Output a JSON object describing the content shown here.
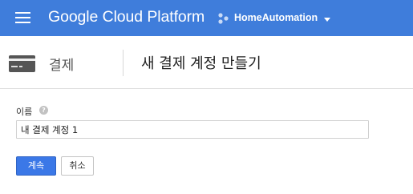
{
  "topbar": {
    "brand": "Google Cloud Platform",
    "project_name": "HomeAutomation",
    "icons": [
      "menu-icon",
      "project-icon",
      "chevron-down-icon"
    ]
  },
  "subheader": {
    "section": "결제",
    "page_title": "새 결제 계정 만들기",
    "icons": [
      "credit-card-icon"
    ]
  },
  "form": {
    "name_label": "이름",
    "help_icon_text": "?",
    "name_value": "내 결제 계정 1"
  },
  "actions": {
    "continue_label": "계속",
    "cancel_label": "취소"
  },
  "colors": {
    "topbar_bg": "#3f7ddb",
    "primary_button": "#3b78e7",
    "divider": "#dddddd"
  }
}
